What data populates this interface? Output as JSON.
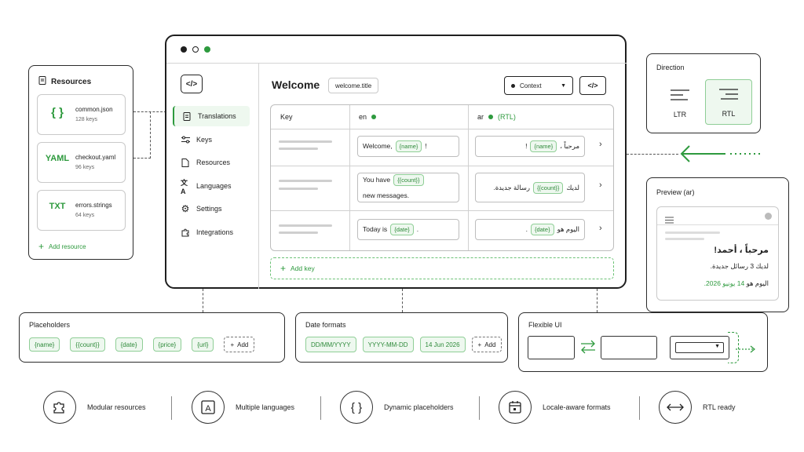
{
  "resources": {
    "title": "Resources",
    "items": [
      {
        "icon_text": "{ }",
        "name": "common.json",
        "keys": "128 keys"
      },
      {
        "icon_text": "YAML",
        "name": "checkout.yaml",
        "keys": "96 keys"
      },
      {
        "icon_text": "TXT",
        "name": "errors.strings",
        "keys": "64 keys"
      }
    ],
    "add_label": "Add resource"
  },
  "sidebar": {
    "logo": "</>",
    "items": [
      {
        "label": "Translations",
        "icon": "document-icon"
      },
      {
        "label": "Keys",
        "icon": "sliders-icon"
      },
      {
        "label": "Resources",
        "icon": "file-icon"
      },
      {
        "label": "Languages",
        "icon": "translate-icon"
      },
      {
        "label": "Settings",
        "icon": "gear-icon"
      },
      {
        "label": "Integrations",
        "icon": "puzzle-icon"
      }
    ]
  },
  "header": {
    "title": "Welcome",
    "key_name": "welcome.title",
    "context_label": "Context",
    "code_label": "</>"
  },
  "table": {
    "col_key": "Key",
    "col_en": "en",
    "col_ar": "ar",
    "col_ar_note": "(RTL)",
    "rows": [
      {
        "en_before": "Welcome,",
        "en_ph": "{name}",
        "en_after": "!",
        "ar_before": "مرحباً ،",
        "ar_ph": "{name}",
        "ar_after": "!"
      },
      {
        "en_before": "You have",
        "en_ph": "{{count}}",
        "en_after": "new messages.",
        "ar_before": "لديك",
        "ar_ph": "{{count}}",
        "ar_after": "رسالة جديدة."
      },
      {
        "en_before": "Today is",
        "en_ph": "{date}",
        "en_after": ".",
        "ar_before": "اليوم هو",
        "ar_ph": "{date}",
        "ar_after": "."
      }
    ],
    "add_key_label": "Add key"
  },
  "direction": {
    "title": "Direction",
    "ltr": "LTR",
    "rtl": "RTL",
    "selected": "RTL"
  },
  "preview": {
    "title": "Preview (ar)",
    "greeting": "مرحباً ، أحمد!",
    "messages": "لديك 3 رسائل جديدة.",
    "date_prefix": "اليوم هو",
    "date_value": "14 يونيو 2026."
  },
  "placeholders": {
    "title": "Placeholders",
    "chips": [
      "{name}",
      "{{count}}",
      "{date}",
      "{price}",
      "{url}"
    ],
    "add_label": "Add"
  },
  "date_formats": {
    "title": "Date formats",
    "chips": [
      "DD/MM/YYYY",
      "YYYY-MM-DD",
      "14 Jun 2026"
    ],
    "add_label": "Add"
  },
  "flexible_ui": {
    "title": "Flexible UI"
  },
  "features": [
    {
      "label": "Modular resources",
      "icon": "puzzle-icon"
    },
    {
      "label": "Multiple languages",
      "icon": "letter-a-icon"
    },
    {
      "label": "Dynamic placeholders",
      "icon": "braces-icon"
    },
    {
      "label": "Locale-aware formats",
      "icon": "calendar-icon"
    },
    {
      "label": "RTL ready",
      "icon": "bidirectional-arrow-icon"
    }
  ],
  "colors": {
    "accent": "#2e9a3e",
    "accent_bg": "#eef8ef",
    "border": "#2b2b2b"
  }
}
